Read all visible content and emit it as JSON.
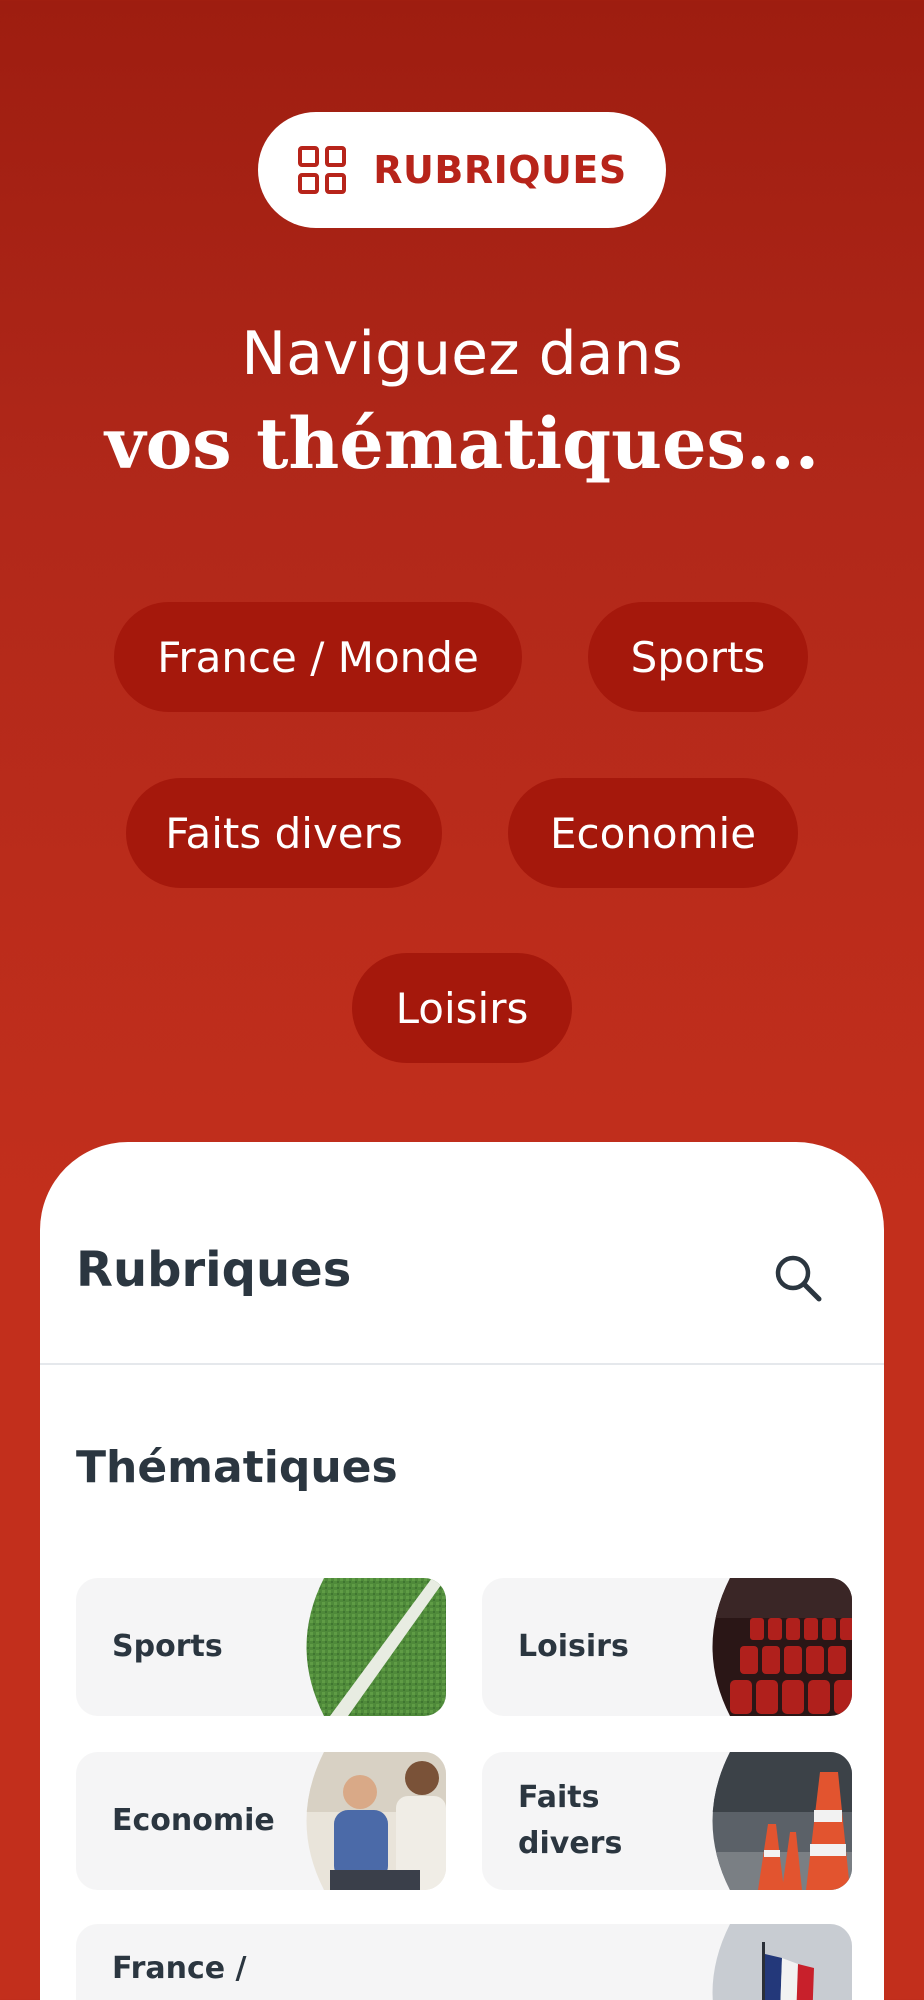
{
  "header": {
    "pill_label": "RUBRIQUES",
    "pill_icon": "grid-icon",
    "headline_line1": "Naviguez dans",
    "headline_line2": "vos thématiques..."
  },
  "chips": [
    "France / Monde",
    "Sports",
    "Faits divers",
    "Economie",
    "Loisirs"
  ],
  "card": {
    "title": "Rubriques",
    "search_icon": "search-icon",
    "section_title": "Thématiques",
    "tiles": [
      {
        "label": "Sports",
        "image": "grass-field-image"
      },
      {
        "label": "Loisirs",
        "image": "theater-seats-image"
      },
      {
        "label": "Economie",
        "image": "business-meeting-image"
      },
      {
        "label": "Faits divers",
        "image": "traffic-cones-image"
      },
      {
        "label": "France /",
        "image": "french-flag-image"
      }
    ]
  },
  "colors": {
    "brand_red": "#c22f1c",
    "chip_red": "#a5180c",
    "pill_text": "#b7241a",
    "text_dark": "#2b3640"
  }
}
